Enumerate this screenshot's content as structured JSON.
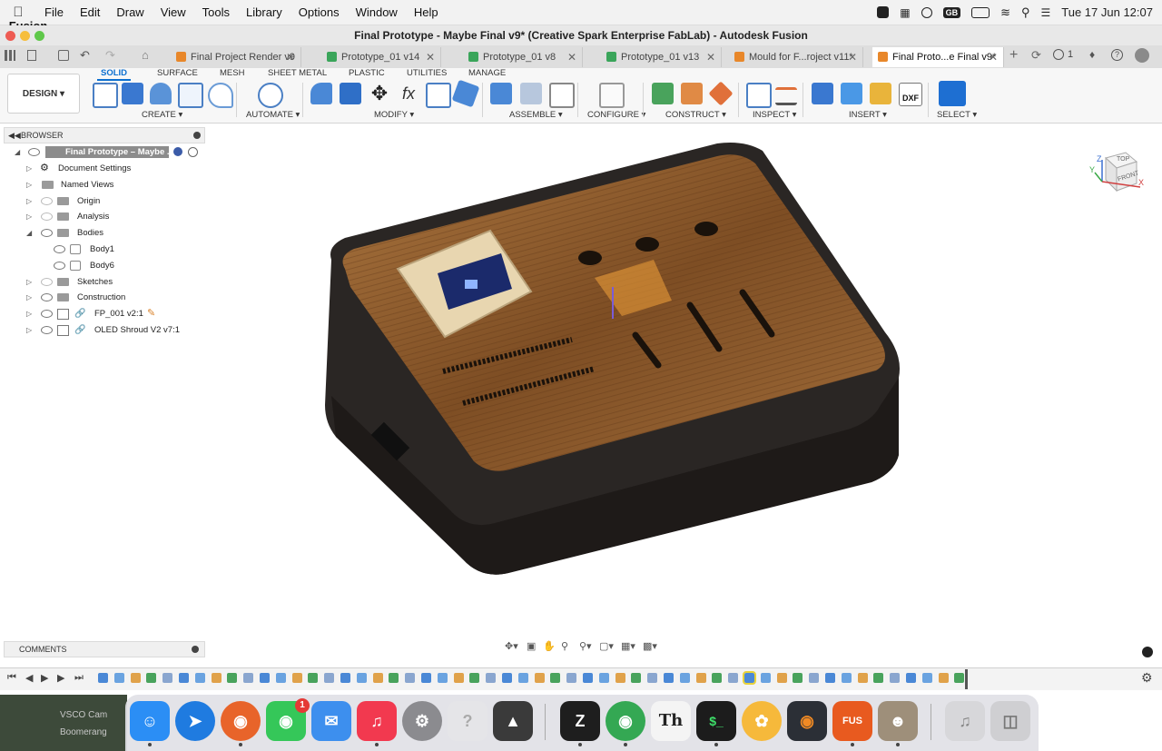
{
  "menubar": {
    "apple_icon": "apple-logo-icon",
    "items": [
      "Fusion",
      "File",
      "Edit",
      "Draw",
      "View",
      "Tools",
      "Library",
      "Options",
      "Window",
      "Help"
    ],
    "input_badge": "GB",
    "datetime": "Tue 17 Jun  12:07"
  },
  "window": {
    "title": "Final Prototype - Maybe Final v9* (Creative Spark Enterprise FabLab) - Autodesk Fusion"
  },
  "tabs": [
    {
      "label": "Final Project Render v9",
      "icon": "part-icon",
      "color": "#e8872a"
    },
    {
      "label": "Prototype_01 v14",
      "icon": "drawing-icon",
      "color": "#3aa55a"
    },
    {
      "label": "Prototype_01 v8",
      "icon": "drawing-icon",
      "color": "#3aa55a"
    },
    {
      "label": "Prototype_01 v13",
      "icon": "drawing-icon",
      "color": "#3aa55a"
    },
    {
      "label": "Mould for F...roject v11*",
      "icon": "part-icon",
      "color": "#e8872a"
    },
    {
      "label": "Final Proto...e Final v9*",
      "icon": "part-icon",
      "color": "#e8872a"
    }
  ],
  "tab_controls": {
    "notification_count": "1"
  },
  "ribbon": {
    "workspace": "DESIGN",
    "tabs": [
      "SOLID",
      "SURFACE",
      "MESH",
      "SHEET METAL",
      "PLASTIC",
      "UTILITIES",
      "MANAGE"
    ],
    "active_tab": "SOLID",
    "groups": [
      "CREATE",
      "AUTOMATE",
      "MODIFY",
      "ASSEMBLE",
      "CONFIGURE",
      "CONSTRUCT",
      "INSPECT",
      "INSERT",
      "SELECT"
    ],
    "insert_dxf_label": "DXF",
    "modify_fx_label": "fx",
    "accent": "#0b6fd0"
  },
  "browser": {
    "title": "BROWSER",
    "root": "Final Prototype – Maybe ...",
    "items": [
      {
        "label": "Document Settings",
        "icon": "gear-icon"
      },
      {
        "label": "Named Views",
        "icon": "folder-icon"
      },
      {
        "label": "Origin",
        "icon": "folder-icon"
      },
      {
        "label": "Analysis",
        "icon": "folder-icon"
      },
      {
        "label": "Bodies",
        "icon": "folder-icon"
      },
      {
        "label": "Body1",
        "icon": "body-icon"
      },
      {
        "label": "Body6",
        "icon": "body-icon"
      },
      {
        "label": "Sketches",
        "icon": "folder-icon"
      },
      {
        "label": "Construction",
        "icon": "folder-icon"
      },
      {
        "label": "FP_001 v2:1",
        "icon": "component-link-icon"
      },
      {
        "label": "OLED Shroud V2 v7:1",
        "icon": "component-link-icon"
      }
    ]
  },
  "comments": {
    "title": "COMMENTS"
  },
  "viewcube": {
    "top": "TOP",
    "front": "FRONT",
    "axis_z": "Z",
    "axis_x": "X",
    "axis_y": "Y"
  },
  "dock": {
    "apps": [
      {
        "name": "Finder",
        "icon": "finder-icon",
        "color": "#2b8ef5"
      },
      {
        "name": "Safari",
        "icon": "safari-icon",
        "color": "#1f7be0"
      },
      {
        "name": "Firefox",
        "icon": "firefox-icon",
        "color": "#e8642a"
      },
      {
        "name": "Messages",
        "icon": "messages-icon",
        "color": "#35c759",
        "badge": "1"
      },
      {
        "name": "Mail",
        "icon": "mail-icon",
        "color": "#3d8fee"
      },
      {
        "name": "Music",
        "icon": "music-icon",
        "color": "#f2394f"
      },
      {
        "name": "System Settings",
        "icon": "settings-icon",
        "color": "#8b8b8f"
      },
      {
        "name": "Help",
        "icon": "question-icon",
        "color": "#d0d0d3"
      },
      {
        "name": "Inkscape",
        "icon": "inkscape-icon",
        "color": "#3a3a3a"
      },
      {
        "name": "Zed",
        "icon": "zed-icon",
        "color": "#1e1e1e"
      },
      {
        "name": "Chrome",
        "icon": "chrome-icon",
        "color": "#34a853"
      },
      {
        "name": "Typeface",
        "icon": "typeface-icon",
        "color": "#f4f4f4"
      },
      {
        "name": "Terminal",
        "icon": "terminal-icon",
        "color": "#1c1c1c"
      },
      {
        "name": "Photos",
        "icon": "photos-icon",
        "color": "#f6b93b"
      },
      {
        "name": "Blender",
        "icon": "blender-icon",
        "color": "#2b2f36"
      },
      {
        "name": "Fusion",
        "icon": "fusion-icon",
        "color": "#e85a1f",
        "label": "FUS"
      },
      {
        "name": "GIMP",
        "icon": "gimp-icon",
        "color": "#9e8f7a"
      },
      {
        "name": "Music Folder",
        "icon": "music-folder-icon",
        "color": "#d7d7da"
      },
      {
        "name": "Trash",
        "icon": "trash-icon",
        "color": "#cfcfd2"
      }
    ]
  },
  "background": {
    "items": [
      "VSCO Cam",
      "Boomerang"
    ]
  }
}
